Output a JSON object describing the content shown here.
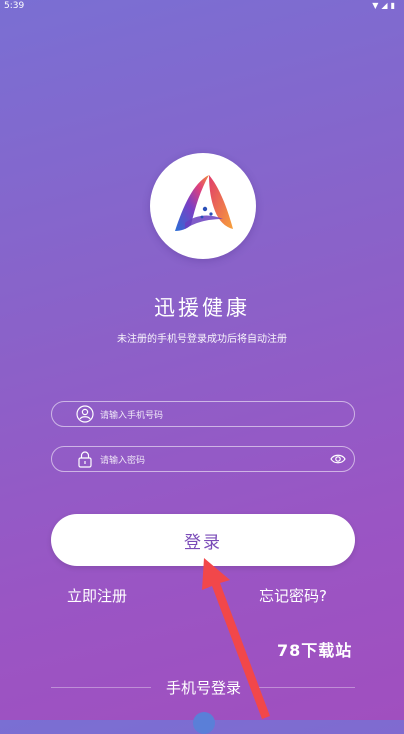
{
  "status_bar": {
    "time": "5:39",
    "icons": "▼◢▮"
  },
  "app": {
    "title": "迅援健康",
    "subtitle": "未注册的手机号登录成功后将自动注册"
  },
  "form": {
    "phone_placeholder": "请输入手机号码",
    "password_placeholder": "请输入密码"
  },
  "actions": {
    "login_label": "登录",
    "register_label": "立即注册",
    "forgot_label": "忘记密码?"
  },
  "footer": {
    "alt_login_label": "手机号登录",
    "watermark": "78下载站"
  },
  "colors": {
    "background_top": "#7a6fd3",
    "background_bottom": "#a04fbf",
    "accent": "#7a4bb8",
    "arrow": "#f2474a"
  }
}
